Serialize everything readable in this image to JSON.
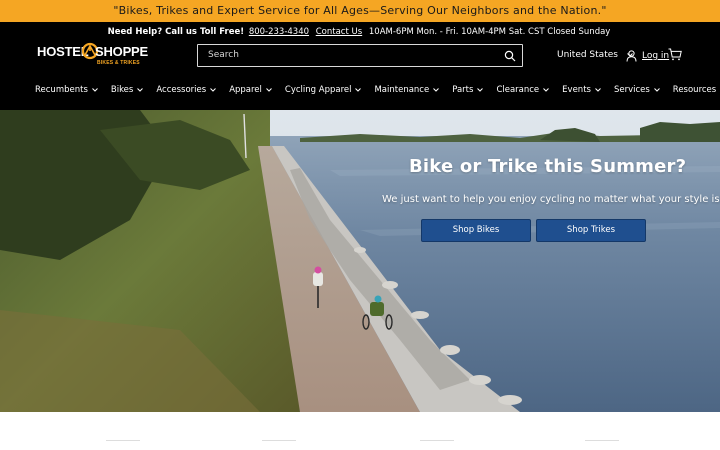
{
  "announcement": "\"Bikes, Trikes and Expert Service for All Ages—Serving Our Neighbors and the Nation.\"",
  "help_bar": {
    "prefix": "Need Help? Call us Toll Free!",
    "phone": "800-233-4340",
    "contact": "Contact Us",
    "hours": "10AM-6PM Mon. - Fri.  10AM-4PM Sat. CST  Closed Sunday"
  },
  "logo": {
    "word1": "HOSTEL",
    "word2": "SHOPPE",
    "tagline": "BIKES & TRIKES"
  },
  "search": {
    "placeholder": "Search"
  },
  "header": {
    "country": "United States",
    "login": "Log in"
  },
  "nav": [
    {
      "label": "Recumbents"
    },
    {
      "label": "Bikes"
    },
    {
      "label": "Accessories"
    },
    {
      "label": "Apparel"
    },
    {
      "label": "Cycling Apparel"
    },
    {
      "label": "Maintenance"
    },
    {
      "label": "Parts"
    },
    {
      "label": "Clearance"
    },
    {
      "label": "Events"
    },
    {
      "label": "Services"
    },
    {
      "label": "Resources"
    }
  ],
  "hero": {
    "title": "Bike or Trike this Summer?",
    "subtitle": "We just want to help you enjoy cycling no matter what your style is!",
    "button_bikes": "Shop Bikes",
    "button_trikes": "Shop Trikes"
  },
  "colors": {
    "announcement_bg": "#f5a623",
    "header_bg": "#000000",
    "button_bg": "#1f4f8f"
  },
  "icons": [
    "search-icon",
    "user-icon",
    "cart-icon",
    "chevron-down-icon",
    "bicycle-logo-icon"
  ]
}
